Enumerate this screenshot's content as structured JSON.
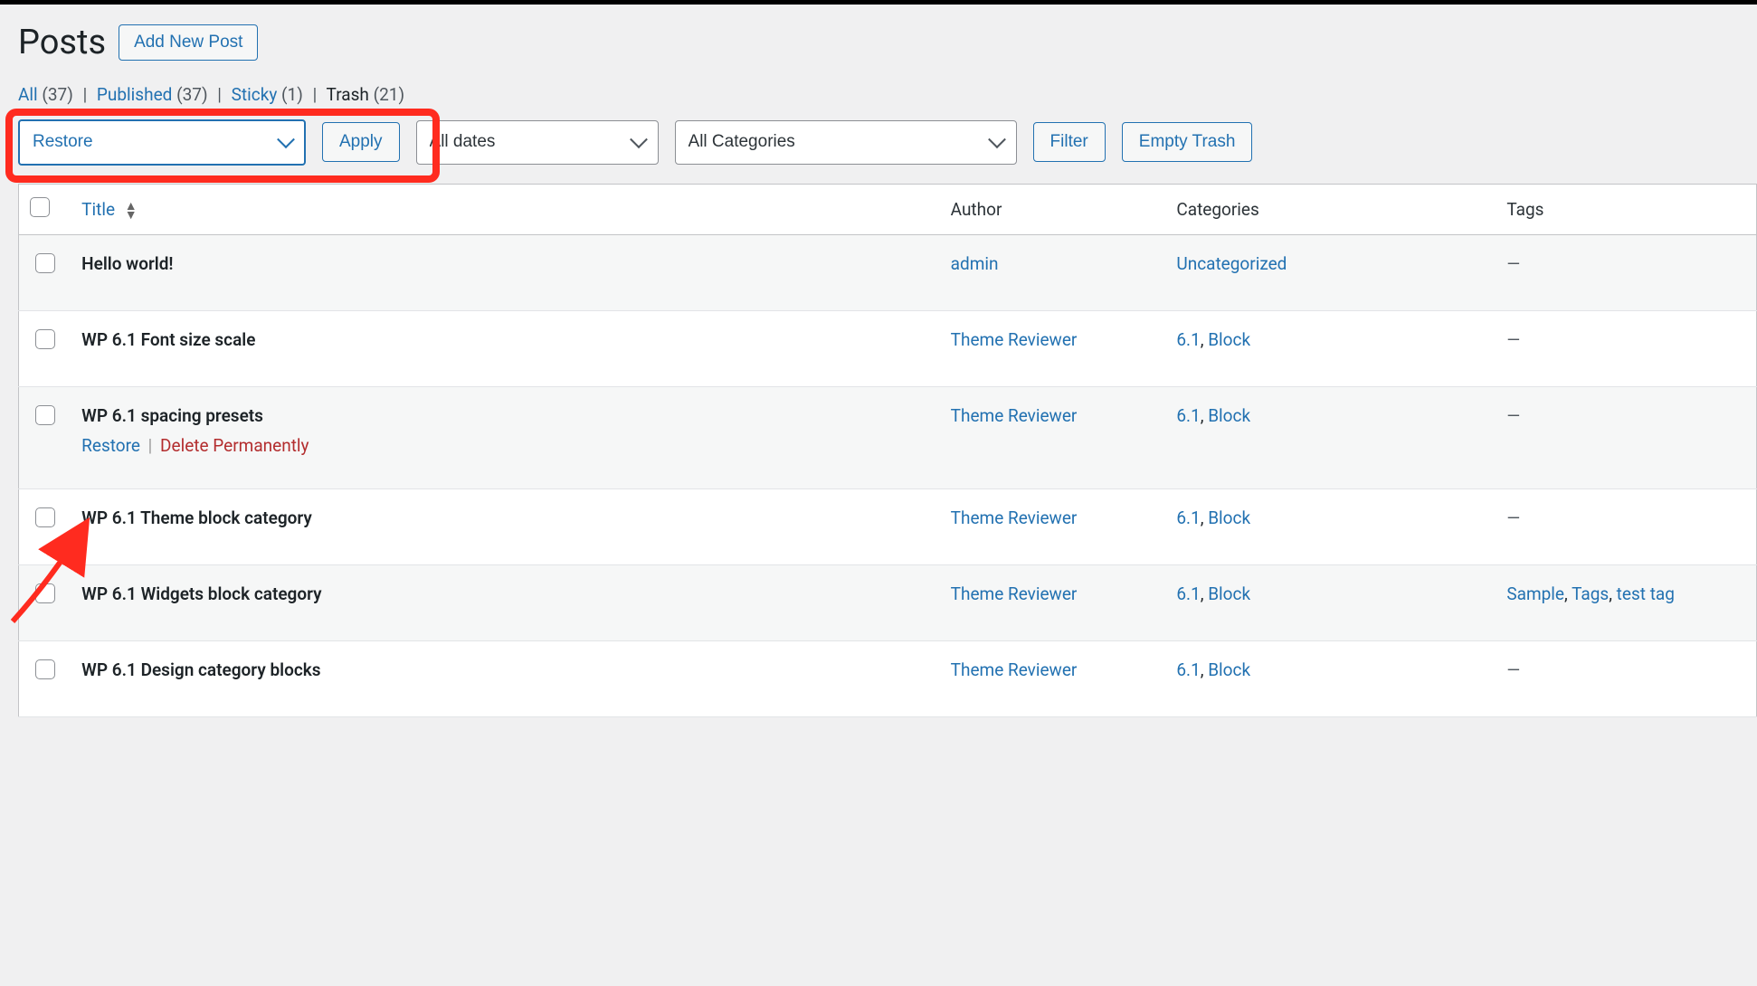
{
  "header": {
    "title": "Posts",
    "add_new": "Add New Post"
  },
  "status_filters": {
    "all": {
      "label": "All",
      "count": "(37)"
    },
    "published": {
      "label": "Published",
      "count": "(37)"
    },
    "sticky": {
      "label": "Sticky",
      "count": "(1)"
    },
    "trash": {
      "label": "Trash",
      "count": "(21)"
    }
  },
  "toolbar": {
    "bulk_action": "Restore",
    "apply": "Apply",
    "date_filter": "All dates",
    "cat_filter": "All Categories",
    "filter": "Filter",
    "empty_trash": "Empty Trash"
  },
  "columns": {
    "title": "Title",
    "author": "Author",
    "categories": "Categories",
    "tags": "Tags"
  },
  "row_actions": {
    "restore": "Restore",
    "delete": "Delete Permanently"
  },
  "rows": [
    {
      "title": "Hello world!",
      "author": "admin",
      "categories": [
        {
          "text": "Uncategorized"
        }
      ],
      "tags": null,
      "show_actions": false
    },
    {
      "title": "WP 6.1 Font size scale",
      "author": "Theme Reviewer",
      "categories": [
        {
          "text": "6.1"
        },
        {
          "text": "Block"
        }
      ],
      "tags": null,
      "show_actions": false
    },
    {
      "title": "WP 6.1 spacing presets",
      "author": "Theme Reviewer",
      "categories": [
        {
          "text": "6.1"
        },
        {
          "text": "Block"
        }
      ],
      "tags": null,
      "show_actions": true
    },
    {
      "title": "WP 6.1 Theme block category",
      "author": "Theme Reviewer",
      "categories": [
        {
          "text": "6.1"
        },
        {
          "text": "Block"
        }
      ],
      "tags": null,
      "show_actions": false
    },
    {
      "title": "WP 6.1 Widgets block category",
      "author": "Theme Reviewer",
      "categories": [
        {
          "text": "6.1"
        },
        {
          "text": "Block"
        }
      ],
      "tags": [
        {
          "text": "Sample"
        },
        {
          "text": "Tags"
        },
        {
          "text": "test tag"
        }
      ],
      "show_actions": false
    },
    {
      "title": "WP 6.1 Design category blocks",
      "author": "Theme Reviewer",
      "categories": [
        {
          "text": "6.1"
        },
        {
          "text": "Block"
        }
      ],
      "tags": null,
      "show_actions": false
    }
  ]
}
